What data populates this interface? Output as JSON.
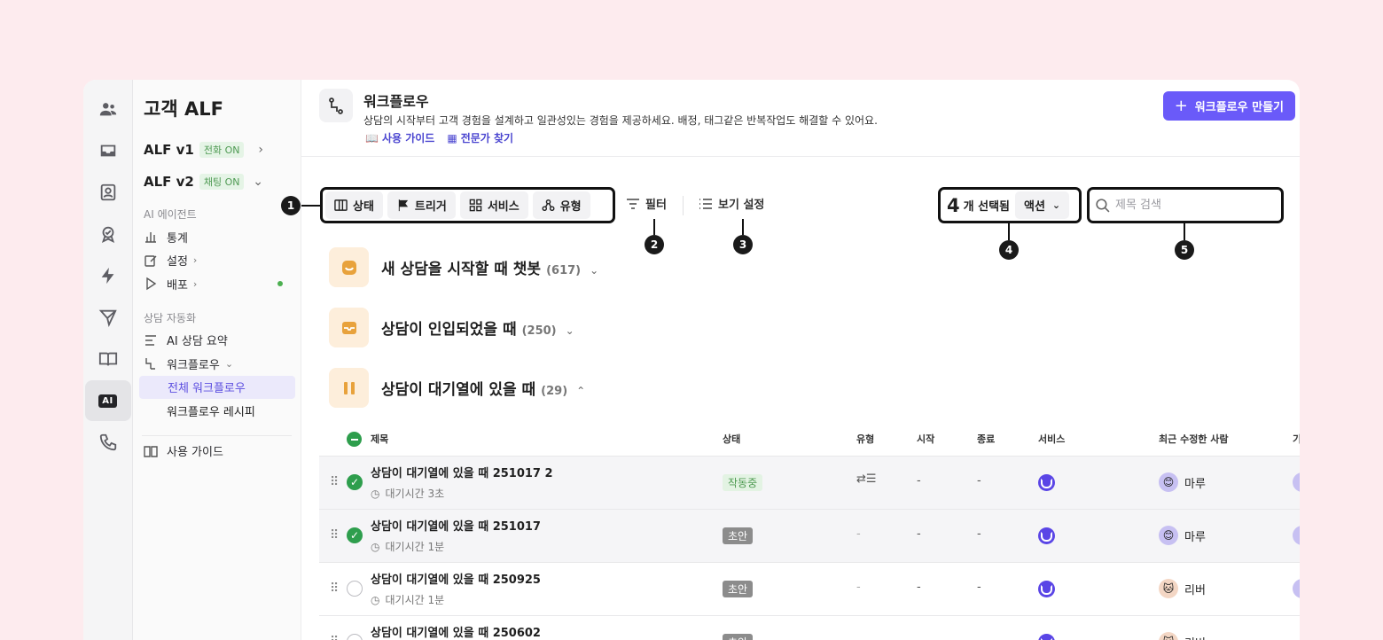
{
  "sidebar": {
    "title": "고객 ALF",
    "versions": [
      {
        "name": "ALF v1",
        "badge": "전화 ON",
        "chevron": "›"
      },
      {
        "name": "ALF v2",
        "badge": "채팅 ON",
        "chevron": "⌄"
      }
    ],
    "sections": [
      {
        "label": "AI 에이전트",
        "items": [
          "통계",
          "설정",
          "배포"
        ]
      },
      {
        "label": "상담 자동화",
        "items": [
          "AI 상담 요약",
          "워크플로우"
        ]
      }
    ],
    "sub_items": [
      "전체 워크플로우",
      "워크플로우 레시피"
    ],
    "guide": "사용 가이드"
  },
  "header": {
    "title": "워크플로우",
    "description": "상담의 시작부터 고객 경험을 설계하고 일관성있는 경험을 제공하세요. 배정, 태그같은 반복작업도 해결할 수 있어요.",
    "links": [
      "사용 가이드",
      "전문가 찾기"
    ],
    "create_button": "워크플로우 만들기"
  },
  "toolbar": {
    "group": [
      "상태",
      "트리거",
      "서비스",
      "유형"
    ],
    "filter": "필터",
    "view_settings": "보기 설정",
    "selected_count": "4",
    "selected_text": "개 선택됨",
    "action": "액션",
    "search_placeholder": "제목 검색"
  },
  "callouts": [
    "1",
    "2",
    "3",
    "4",
    "5"
  ],
  "groups": [
    {
      "title": "새 상담을 시작할 때 챗봇",
      "count": "(617)",
      "icon": "chatbot-icon",
      "chevron": "⌄"
    },
    {
      "title": "상담이 인입되었을 때",
      "count": "(250)",
      "icon": "inbox-icon",
      "chevron": "⌄"
    },
    {
      "title": "상담이 대기열에 있을 때",
      "count": "(29)",
      "icon": "pause-icon",
      "chevron": "⌃"
    }
  ],
  "table": {
    "headers": [
      "제목",
      "상태",
      "유형",
      "시작",
      "종료",
      "서비스",
      "최근 수정한 사람",
      "기"
    ],
    "rows": [
      {
        "title": "상담이 대기열에 있을 때 251017 2",
        "sub": "대기시간 3초",
        "status": "작동중",
        "type": "icon",
        "start": "-",
        "end": "-",
        "user": "마루",
        "selected": true
      },
      {
        "title": "상담이 대기열에 있을 때 251017",
        "sub": "대기시간 1분",
        "status": "초안",
        "type": "-",
        "start": "-",
        "end": "-",
        "user": "마루",
        "selected": true
      },
      {
        "title": "상담이 대기열에 있을 때 250925",
        "sub": "대기시간 1분",
        "status": "초안",
        "type": "-",
        "start": "-",
        "end": "-",
        "user": "리버",
        "selected": false
      },
      {
        "title": "상담이 대기열에 있을 때 250602",
        "sub": "",
        "status": "초안",
        "type": "",
        "start": "",
        "end": "",
        "user": "리버",
        "selected": false
      }
    ]
  },
  "colors": {
    "accent": "#6a5af9",
    "group_icon_bg": "#fdeedb",
    "group_icon": "#e8a23c",
    "active_green": "#2e9e4d"
  }
}
